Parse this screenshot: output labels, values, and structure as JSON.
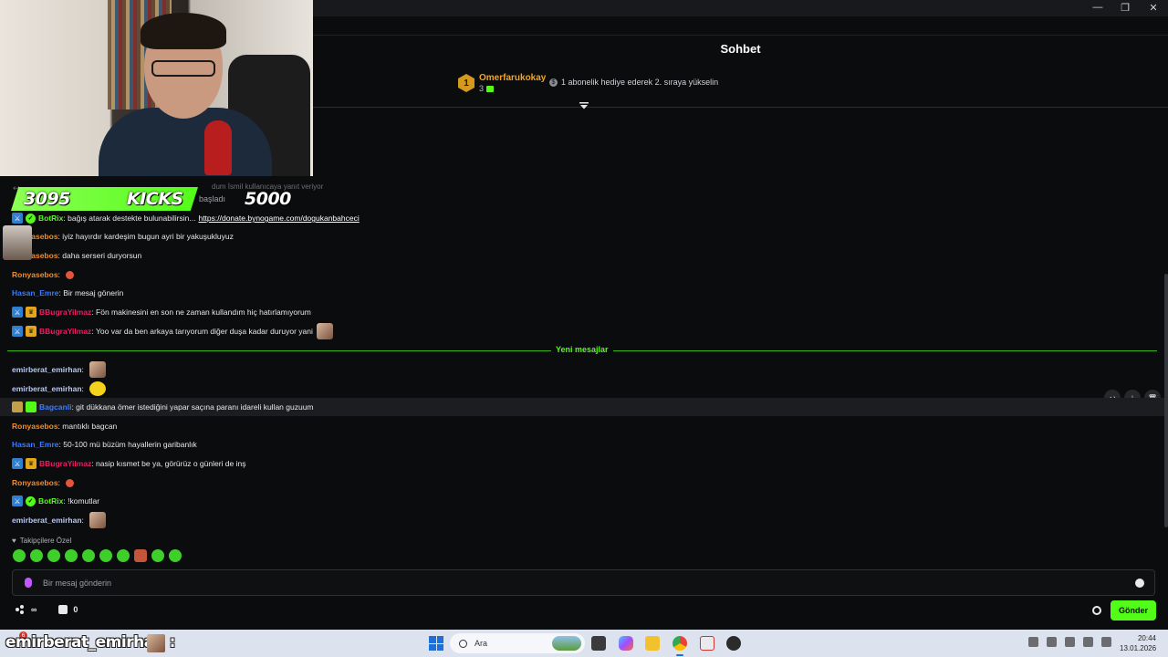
{
  "header": {
    "title": "Sohbet"
  },
  "window_controls": {
    "minimize": "—",
    "restore": "❐",
    "close": "✕"
  },
  "leaderboard": {
    "rank": "1",
    "name": "Omerfarukokay",
    "count": "3",
    "info": "1 abonelik hediye ederek 2. sıraya yükselin"
  },
  "overlay": {
    "kicks_count": "3095",
    "kicks_label": "KICKS",
    "kicks_goal": "5000",
    "ghost_note": "dum İsmil kullanıcaya yanıt veriyor",
    "ghost_note2": "başladı"
  },
  "messages": [
    {
      "user": "BotRix",
      "color": "#53fc18",
      "badges": [
        "mod",
        "verified"
      ],
      "text": "bağış atarak destekte bulunabilirsin...",
      "link": "https://donate.bynogame.com/dogukanbahceci"
    },
    {
      "user": "Ronyasebos",
      "color": "#f28c28",
      "badges": [],
      "text": "iyiz hayırdır kardeşim bugun ayri bir yakuşukluyuz"
    },
    {
      "user": "Ronyasebos",
      "color": "#f28c28",
      "badges": [],
      "text": "daha serseri duryorsun"
    },
    {
      "user": "Ronyasebos",
      "color": "#f28c28",
      "badges": [],
      "text": "",
      "emote": "red"
    },
    {
      "user": "Hasan_Emre",
      "color": "#3b7bff",
      "badges": [],
      "text": "Bir mesaj gönerin"
    },
    {
      "user": "BBugraYilmaz",
      "color": "#e91e63",
      "badges": [
        "mod",
        "crown"
      ],
      "text": "Fön makinesini en son ne zaman kullandım hiç hatırlamıyorum"
    },
    {
      "user": "BBugraYilmaz",
      "color": "#e91e63",
      "badges": [
        "mod",
        "crown"
      ],
      "text": "Yoo var da ben arkaya tarıyorum diğer duşa kadar duruyor yani",
      "emote": "img"
    },
    {
      "user": "emirberat_emirhan",
      "color": "#b9c8f0",
      "badges": [],
      "text": "",
      "emote": "img"
    },
    {
      "user": "emirberat_emirhan",
      "color": "#b9c8f0",
      "badges": [],
      "text": "",
      "emote": "yellow"
    },
    {
      "user": "Bagcanli",
      "color": "#3b7bff",
      "badges": [
        "gift",
        "sub"
      ],
      "text": "git dükkana ömer istediğini yapar saçına paranı idareli kullan guzuum",
      "highlight": true
    },
    {
      "user": "Ronyasebos",
      "color": "#f28c28",
      "badges": [],
      "text": "mantıklı bagcan"
    },
    {
      "user": "Hasan_Emre",
      "color": "#3b7bff",
      "badges": [],
      "text": "50-100 mü büzüm hayallerin garibanlık"
    },
    {
      "user": "BBugraYilmaz",
      "color": "#e91e63",
      "badges": [
        "mod",
        "crown"
      ],
      "text": "nasip kısmet be ya, görürüz o günleri de inş"
    },
    {
      "user": "Ronyasebos",
      "color": "#f28c28",
      "badges": [],
      "text": "",
      "emote": "red"
    },
    {
      "user": "BotRix",
      "color": "#53fc18",
      "badges": [
        "mod",
        "verified"
      ],
      "text": "!komutlar"
    },
    {
      "user": "emirberat_emirhan",
      "color": "#b9c8f0",
      "badges": [],
      "text": "",
      "emote": "img"
    }
  ],
  "separator": {
    "label": "Yeni mesajlar"
  },
  "followers": {
    "label": "Takipçilere Özel"
  },
  "input": {
    "placeholder": "Bir mesaj gönderin"
  },
  "bottom": {
    "points": "∞",
    "chest_count": "0",
    "send_label": "Gönder"
  },
  "taskbar": {
    "overlay_text": "emirberat_emirhan :",
    "notification_count": "6",
    "search_placeholder": "Ara",
    "time": "20:44",
    "date": "13.01.2026"
  }
}
